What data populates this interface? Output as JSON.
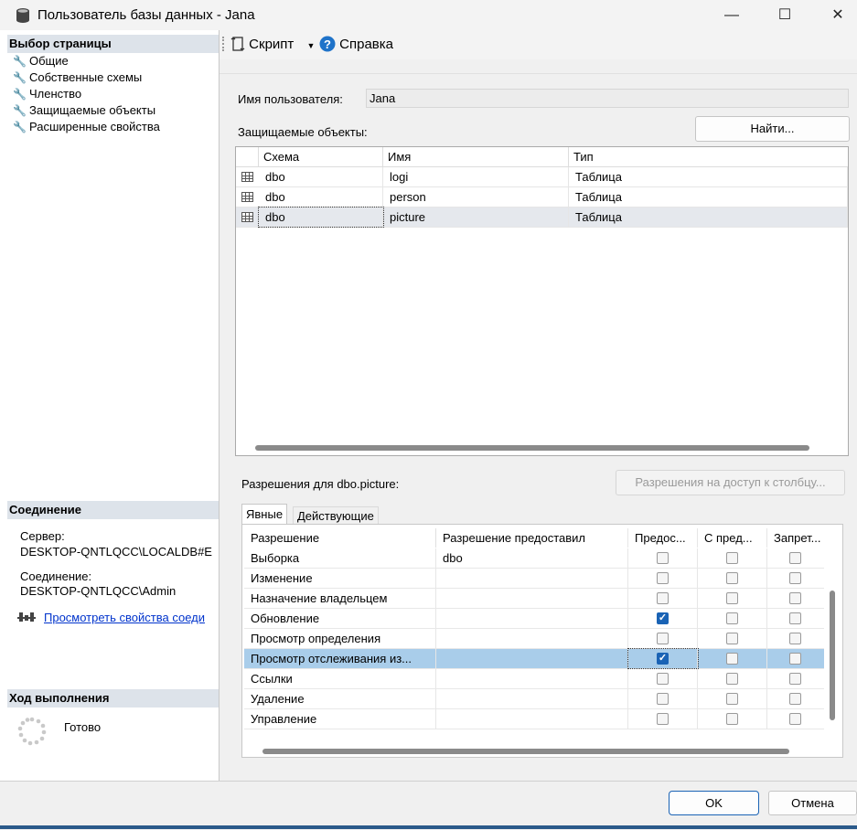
{
  "window": {
    "title": "Пользователь базы данных - Jana",
    "minimize": "—",
    "maximize": "☐",
    "close": "✕"
  },
  "left": {
    "select_page_header": "Выбор страницы",
    "pages": [
      "Общие",
      "Собственные схемы",
      "Членство",
      "Защищаемые объекты",
      "Расширенные свойства"
    ],
    "connection_header": "Соединение",
    "server_label": "Сервер:",
    "server_value": "DESKTOP-QNTLQCC\\LOCALDB#E",
    "connection_label": "Соединение:",
    "connection_value": "DESKTOP-QNTLQCC\\Admin",
    "view_properties_link": "Просмотреть свойства соеди",
    "progress_header": "Ход выполнения",
    "progress_status": "Готово"
  },
  "toolbar": {
    "script_label": "Скрипт",
    "help_label": "Справка"
  },
  "form": {
    "username_label": "Имя пользователя:",
    "username_value": "Jana",
    "securables_label": "Защищаемые объекты:",
    "find_button": "Найти..."
  },
  "securables": {
    "columns": [
      "Схема",
      "Имя",
      "Тип"
    ],
    "rows": [
      {
        "schema": "dbo",
        "name": "logi",
        "type": "Таблица"
      },
      {
        "schema": "dbo",
        "name": "person",
        "type": "Таблица"
      },
      {
        "schema": "dbo",
        "name": "picture",
        "type": "Таблица"
      }
    ],
    "selected_index": 2
  },
  "permissions": {
    "title": "Разрешения для dbo.picture:",
    "column_perms_button": "Разрешения на доступ к столбцу...",
    "tabs": [
      "Явные",
      "Действующие"
    ],
    "active_tab": 0,
    "columns": [
      "Разрешение",
      "Разрешение предоставил",
      "Предос...",
      "С пред...",
      "Запрет..."
    ],
    "rows": [
      {
        "perm": "Выборка",
        "grantor": "dbo",
        "grant": false,
        "with_grant": false,
        "deny": false
      },
      {
        "perm": "Изменение",
        "grantor": "",
        "grant": false,
        "with_grant": false,
        "deny": false
      },
      {
        "perm": "Назначение владельцем",
        "grantor": "",
        "grant": false,
        "with_grant": false,
        "deny": false
      },
      {
        "perm": "Обновление",
        "grantor": "",
        "grant": true,
        "with_grant": false,
        "deny": false
      },
      {
        "perm": "Просмотр определения",
        "grantor": "",
        "grant": false,
        "with_grant": false,
        "deny": false
      },
      {
        "perm": "Просмотр отслеживания из...",
        "grantor": "",
        "grant": true,
        "with_grant": false,
        "deny": false
      },
      {
        "perm": "Ссылки",
        "grantor": "",
        "grant": false,
        "with_grant": false,
        "deny": false
      },
      {
        "perm": "Удаление",
        "grantor": "",
        "grant": false,
        "with_grant": false,
        "deny": false
      },
      {
        "perm": "Управление",
        "grantor": "",
        "grant": false,
        "with_grant": false,
        "deny": false
      }
    ],
    "selected_index": 5
  },
  "buttons": {
    "ok": "OK",
    "cancel": "Отмена"
  },
  "colors": {
    "accent": "#1a63b5",
    "selection": "#a9cdea",
    "link": "#0033cc"
  }
}
